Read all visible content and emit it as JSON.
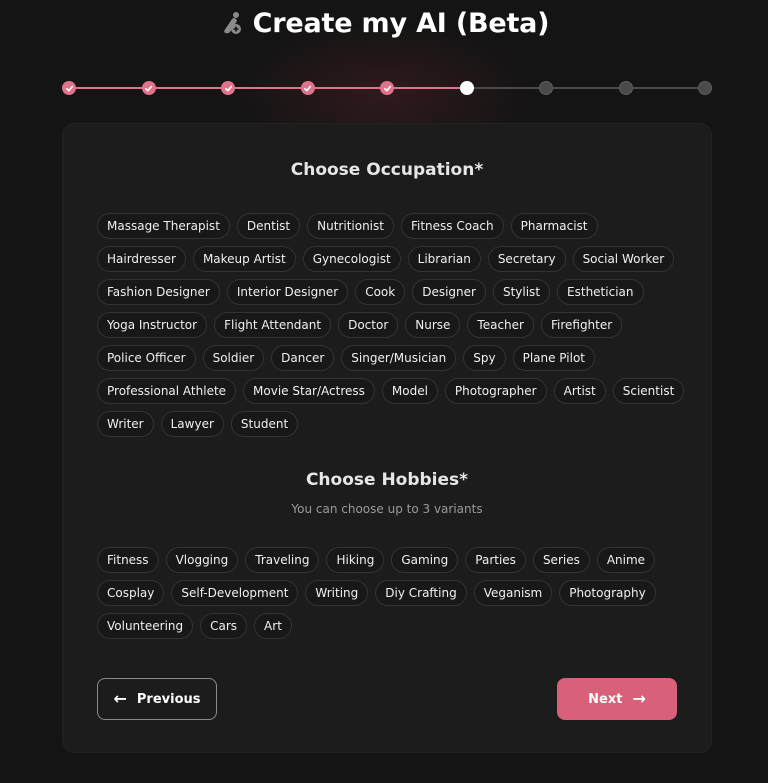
{
  "header": {
    "title": "Create my AI (Beta)",
    "icon": "edit-person-icon"
  },
  "stepper": {
    "total_steps": 9,
    "completed_steps": 5,
    "current_step": 6,
    "colors": {
      "done": "#e0738a",
      "current": "#ffffff",
      "todo": "#4a4a4a"
    }
  },
  "occupation": {
    "title": "Choose Occupation*",
    "options": [
      "Massage Therapist",
      "Dentist",
      "Nutritionist",
      "Fitness Coach",
      "Pharmacist",
      "Hairdresser",
      "Makeup Artist",
      "Gynecologist",
      "Librarian",
      "Secretary",
      "Social Worker",
      "Fashion Designer",
      "Interior Designer",
      "Cook",
      "Designer",
      "Stylist",
      "Esthetician",
      "Yoga Instructor",
      "Flight Attendant",
      "Doctor",
      "Nurse",
      "Teacher",
      "Firefighter",
      "Police Officer",
      "Soldier",
      "Dancer",
      "Singer/Musician",
      "Spy",
      "Plane Pilot",
      "Professional Athlete",
      "Movie Star/Actress",
      "Model",
      "Photographer",
      "Artist",
      "Scientist",
      "Writer",
      "Lawyer",
      "Student"
    ]
  },
  "hobbies": {
    "title": "Choose Hobbies*",
    "subtitle": "You can choose up to 3 variants",
    "options": [
      "Fitness",
      "Vlogging",
      "Traveling",
      "Hiking",
      "Gaming",
      "Parties",
      "Series",
      "Anime",
      "Cosplay",
      "Self-Development",
      "Writing",
      "Diy Crafting",
      "Veganism",
      "Photography",
      "Volunteering",
      "Cars",
      "Art"
    ]
  },
  "nav": {
    "previous_label": "Previous",
    "next_label": "Next",
    "previous_icon": "arrow-left-icon",
    "next_icon": "arrow-right-icon",
    "accent": "#d8607a"
  }
}
